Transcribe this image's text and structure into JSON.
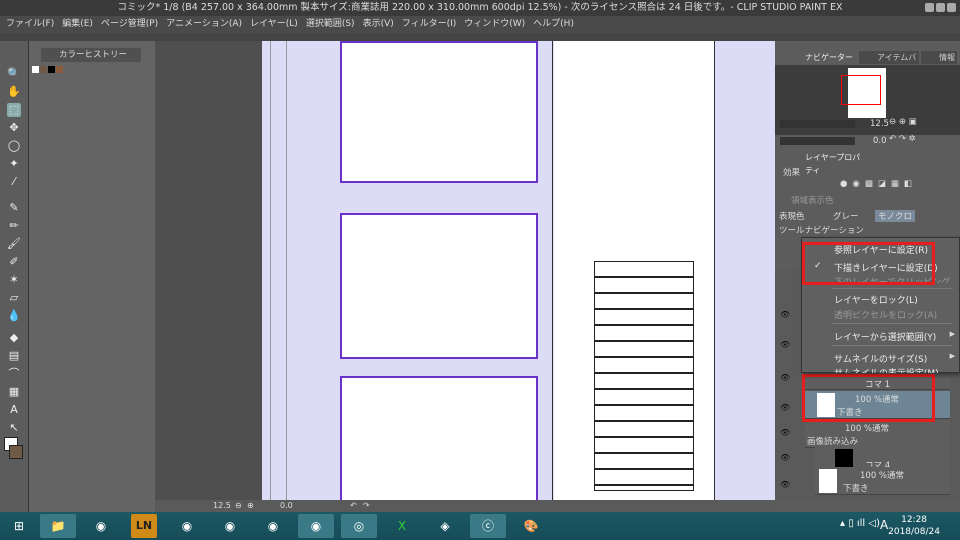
{
  "title": "コミック* 1/8 (B4 257.00 x 364.00mm 製本サイズ:商業誌用 220.00 x 310.00mm 600dpi 12.5%)  - 次のライセンス照合は 24 日後です。- CLIP STUDIO PAINT EX",
  "menu": [
    "ファイル(F)",
    "編集(E)",
    "ページ管理(P)",
    "アニメーション(A)",
    "レイヤー(L)",
    "選択範囲(S)",
    "表示(V)",
    "フィルター(I)",
    "ウィンドウ(W)",
    "ヘルプ(H)"
  ],
  "color_history": {
    "tab": "カラーヒストリー",
    "swatches": [
      "#ffffff",
      "#6e5a46",
      "#000000",
      "#8c5a3c"
    ]
  },
  "navigator": {
    "tabs": [
      "ナビゲーター",
      "アイテムバンク",
      "情報"
    ],
    "zoom": "12.5",
    "rotation": "0.0"
  },
  "layer_property": {
    "tab": "レイヤープロパティ",
    "effect": "効果",
    "area_color": "領域表示色",
    "expression_color": "表現色",
    "gray": "グレー",
    "mono": "モノクロ",
    "tool_nav": "ツールナビゲーション"
  },
  "context_menu": {
    "items": [
      {
        "label": "参照レイヤーに設定(R)",
        "checked": false,
        "disabled": false
      },
      {
        "label": "下描きレイヤーに設定(D)",
        "checked": true,
        "disabled": false
      },
      {
        "label": "下のレイヤーでクリッピング(C)",
        "checked": false,
        "disabled": true
      },
      {
        "label": "レイヤーをロック(L)",
        "checked": false,
        "disabled": false
      },
      {
        "label": "透明ピクセルをロック(A)",
        "checked": false,
        "disabled": true
      },
      {
        "label": "レイヤーから選択範囲(Y)",
        "checked": false,
        "disabled": false
      },
      {
        "label": "サムネイルのサイズ(S)",
        "checked": false,
        "disabled": false
      },
      {
        "label": "サムネイルの表示設定(M)",
        "checked": false,
        "disabled": false
      }
    ],
    "check": "✓",
    "arrow": "▶"
  },
  "layers": [
    {
      "blend": "コマ 1",
      "name": ""
    },
    {
      "blend": "100 %通常",
      "name": "下書き"
    },
    {
      "blend": "100 %通常",
      "name": "画像読み込み"
    },
    {
      "blend": "100 %通常",
      "name": "コマ 4"
    },
    {
      "blend": "100 %通常",
      "name": "下書き"
    }
  ],
  "canvas_status": {
    "zoom": "12.5",
    "rotation": "0.0"
  },
  "taskbar": {
    "apps": [
      "explorer",
      "chrome",
      "LN",
      "chrome",
      "chrome",
      "chrome",
      "chrome",
      "clip",
      "excel",
      "app",
      "clip-studio",
      "paint"
    ],
    "ime": "A",
    "time": "12:28",
    "date": "2018/08/24"
  },
  "accent": "#6a32c8"
}
